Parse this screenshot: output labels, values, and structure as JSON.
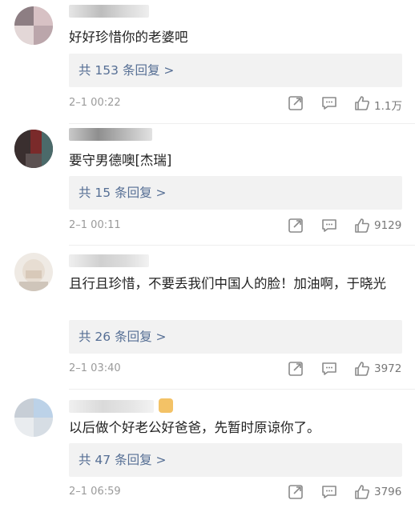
{
  "comments": [
    {
      "text": "好好珍惜你的老婆吧",
      "replies": "共 153 条回复 >",
      "time": "2–1 00:22",
      "likes": "1.1万"
    },
    {
      "text": "要守男德噢[杰瑞]",
      "replies": "共 15 条回复 >",
      "time": "2–1 00:11",
      "likes": "9129"
    },
    {
      "text": "且行且珍惜，不要丢我们中国人的脸！加油啊，于晓光",
      "replies": "共 26 条回复 >",
      "time": "2–1 03:40",
      "likes": "3972"
    },
    {
      "text": "以后做个好老公好爸爸，先暂时原谅你了。",
      "replies": "共 47 条回复 >",
      "time": "2–1 06:59",
      "likes": "3796"
    }
  ],
  "icons": {
    "share": "share-icon",
    "reply": "comment-icon",
    "like": "thumbs-up-icon"
  },
  "colors": {
    "reply_link": "#556e94",
    "reply_bg": "#f2f2f2",
    "muted": "#9a9a9a"
  }
}
